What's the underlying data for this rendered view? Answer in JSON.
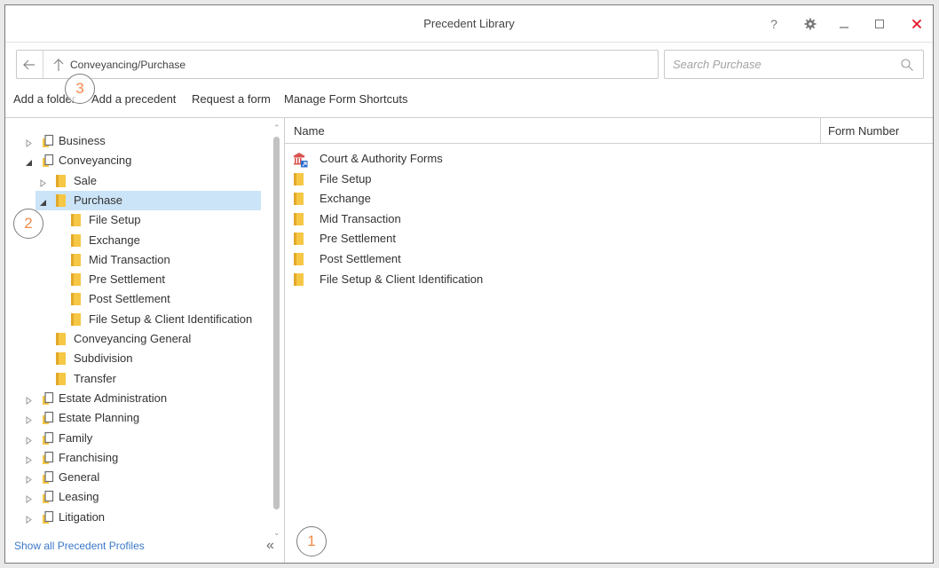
{
  "window": {
    "title": "Precedent Library",
    "help_label": "?"
  },
  "address": {
    "path": "Conveyancing/Purchase"
  },
  "search": {
    "placeholder": "Search Purchase"
  },
  "toolbar": {
    "add_folder": "Add a folder",
    "add_precedent": "Add a precedent",
    "request_form": "Request a form",
    "manage_shortcuts": "Manage Form Shortcuts"
  },
  "tree": {
    "items": [
      {
        "label": "Business",
        "level": 0,
        "state": "collapsed",
        "icon": "book-icon"
      },
      {
        "label": "Conveyancing",
        "level": 0,
        "state": "expanded",
        "icon": "book-icon"
      },
      {
        "label": "Sale",
        "level": 1,
        "state": "collapsed",
        "icon": "folder-icon"
      },
      {
        "label": "Purchase",
        "level": 1,
        "state": "expanded",
        "icon": "folder-icon",
        "selected": true
      },
      {
        "label": "File Setup",
        "level": 2,
        "state": "leaf",
        "icon": "folder-icon"
      },
      {
        "label": "Exchange",
        "level": 2,
        "state": "leaf",
        "icon": "folder-icon"
      },
      {
        "label": "Mid Transaction",
        "level": 2,
        "state": "leaf",
        "icon": "folder-icon"
      },
      {
        "label": "Pre Settlement",
        "level": 2,
        "state": "leaf",
        "icon": "folder-icon"
      },
      {
        "label": "Post Settlement",
        "level": 2,
        "state": "leaf",
        "icon": "folder-icon"
      },
      {
        "label": "File Setup & Client Identification",
        "level": 2,
        "state": "leaf",
        "icon": "folder-icon"
      },
      {
        "label": "Conveyancing General",
        "level": 1,
        "state": "leaf",
        "icon": "folder-icon"
      },
      {
        "label": "Subdivision",
        "level": 1,
        "state": "leaf",
        "icon": "folder-icon"
      },
      {
        "label": "Transfer",
        "level": 1,
        "state": "leaf",
        "icon": "folder-icon"
      },
      {
        "label": "Estate Administration",
        "level": 0,
        "state": "collapsed",
        "icon": "book-icon"
      },
      {
        "label": "Estate Planning",
        "level": 0,
        "state": "collapsed",
        "icon": "book-icon"
      },
      {
        "label": "Family",
        "level": 0,
        "state": "collapsed",
        "icon": "book-icon"
      },
      {
        "label": "Franchising",
        "level": 0,
        "state": "collapsed",
        "icon": "book-icon"
      },
      {
        "label": "General",
        "level": 0,
        "state": "collapsed",
        "icon": "book-icon"
      },
      {
        "label": "Leasing",
        "level": 0,
        "state": "collapsed",
        "icon": "book-icon"
      },
      {
        "label": "Litigation",
        "level": 0,
        "state": "collapsed",
        "icon": "book-icon"
      }
    ],
    "show_all_label": "Show all Precedent Profiles",
    "collapse_label": "«"
  },
  "list": {
    "columns": {
      "name": "Name",
      "form_number": "Form Number"
    },
    "rows": [
      {
        "name": "Court & Authority Forms",
        "icon": "court-authority-icon"
      },
      {
        "name": "File Setup",
        "icon": "folder-icon"
      },
      {
        "name": "Exchange",
        "icon": "folder-icon"
      },
      {
        "name": "Mid Transaction",
        "icon": "folder-icon"
      },
      {
        "name": "Pre Settlement",
        "icon": "folder-icon"
      },
      {
        "name": "Post Settlement",
        "icon": "folder-icon"
      },
      {
        "name": "File Setup & Client Identification",
        "icon": "folder-icon"
      }
    ]
  },
  "markers": [
    "1",
    "2",
    "3"
  ],
  "colors": {
    "accent": "#3b78c8",
    "selection": "#cce4f7",
    "folder": "#f6c745",
    "close": "#e81123",
    "marker_text": "#f08a4b"
  }
}
